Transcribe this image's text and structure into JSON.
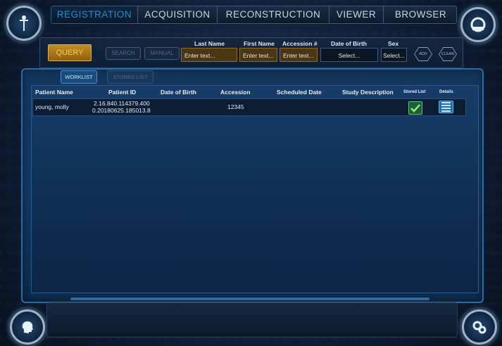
{
  "tabs": [
    {
      "label": "REGISTRATION",
      "active": true
    },
    {
      "label": "ACQUISITION",
      "active": false
    },
    {
      "label": "RECONSTRUCTION",
      "active": false
    },
    {
      "label": "VIEWER",
      "active": false
    },
    {
      "label": "BROWSER",
      "active": false
    }
  ],
  "query": {
    "query_label": "QUERY",
    "search_label": "SEARCH",
    "manual_label": "MANUAL",
    "last_name_label": "Last Name",
    "first_name_label": "First Name",
    "accession_label": "Accession #",
    "dob_label": "Date of Birth",
    "sex_label": "Sex",
    "last_name_placeholder": "Enter text...",
    "first_name_placeholder": "Enter text...",
    "accession_placeholder": "Enter text...",
    "dob_value": "Select...",
    "sex_value": "Select...",
    "add_label": "ADD",
    "clear_label": "CLEAR"
  },
  "subtabs": {
    "worklist": "WORKLIST",
    "stored_list": "STORED LIST"
  },
  "table": {
    "headers": {
      "patient_name": "Patient Name",
      "patient_id": "Patient ID",
      "dob": "Date of Birth",
      "accession": "Accession",
      "scheduled_date": "Scheduled Date",
      "study_description": "Study Description",
      "stored_list": "Stored List",
      "details": "Details"
    },
    "rows": [
      {
        "patient_name": "young, molly",
        "patient_id_line1": "2.16.840.114379.400",
        "patient_id_line2": "0.20180625.185013.8",
        "dob": "",
        "accession": "12345",
        "scheduled_date": "",
        "study_description": "",
        "stored": true
      }
    ]
  },
  "icons": {
    "top_left": "tower-icon",
    "top_right": "scanner-icon",
    "bottom_left": "head-profile-icon",
    "bottom_right": "gears-icon"
  },
  "colors": {
    "accent": "#2f88c8",
    "query_amber": "#c48d24",
    "check_green": "#5fc27f"
  }
}
